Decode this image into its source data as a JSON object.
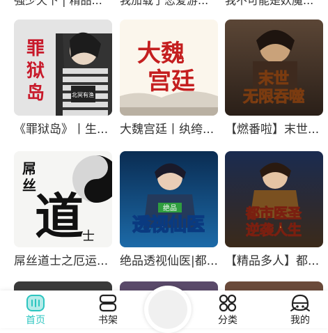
{
  "top_row": [
    "強少天下 | 精品...",
    "我加载了恋爱游...",
    "我不可能是妖魔..."
  ],
  "books": [
    {
      "title": "《罪狱岛》丨生...",
      "cover_text": "罪狱岛",
      "cover_subtext": "北冥有渔",
      "colors": [
        "#f3f3f3",
        "#2a2a2a",
        "#c8192a"
      ]
    },
    {
      "title": "大魏宫廷丨纨绔...",
      "cover_text": "大魏宫廷",
      "cover_subtext": "",
      "colors": [
        "#fbf5ea",
        "#c8c2b8",
        "#c41f1f"
      ]
    },
    {
      "title": "【燃番啦】末世...",
      "cover_text": "末世无限吞噬",
      "cover_subtext": "",
      "colors": [
        "#3a2d25",
        "#c47a3a",
        "#f0e0b0"
      ]
    },
    {
      "title": "屌丝道士之厄运...",
      "cover_text": "屌丝道士",
      "cover_subtext": "",
      "colors": [
        "#f4f4f2",
        "#bdbdbd",
        "#111111"
      ]
    },
    {
      "title": "绝品透视仙医|都...",
      "cover_text": "透视仙医",
      "cover_subtext": "绝品",
      "colors": [
        "#0d3a66",
        "#1d6aa8",
        "#e6f4ff"
      ]
    },
    {
      "title": "【精品多人】都...",
      "cover_text": "都市医圣逆袭人生",
      "cover_subtext": "",
      "colors": [
        "#16294a",
        "#b7842b",
        "#ffd24a"
      ]
    }
  ],
  "nav": {
    "home": "首页",
    "bookshelf": "书架",
    "categories": "分类",
    "mine": "我的"
  },
  "accent_color": "#2cc5c0"
}
